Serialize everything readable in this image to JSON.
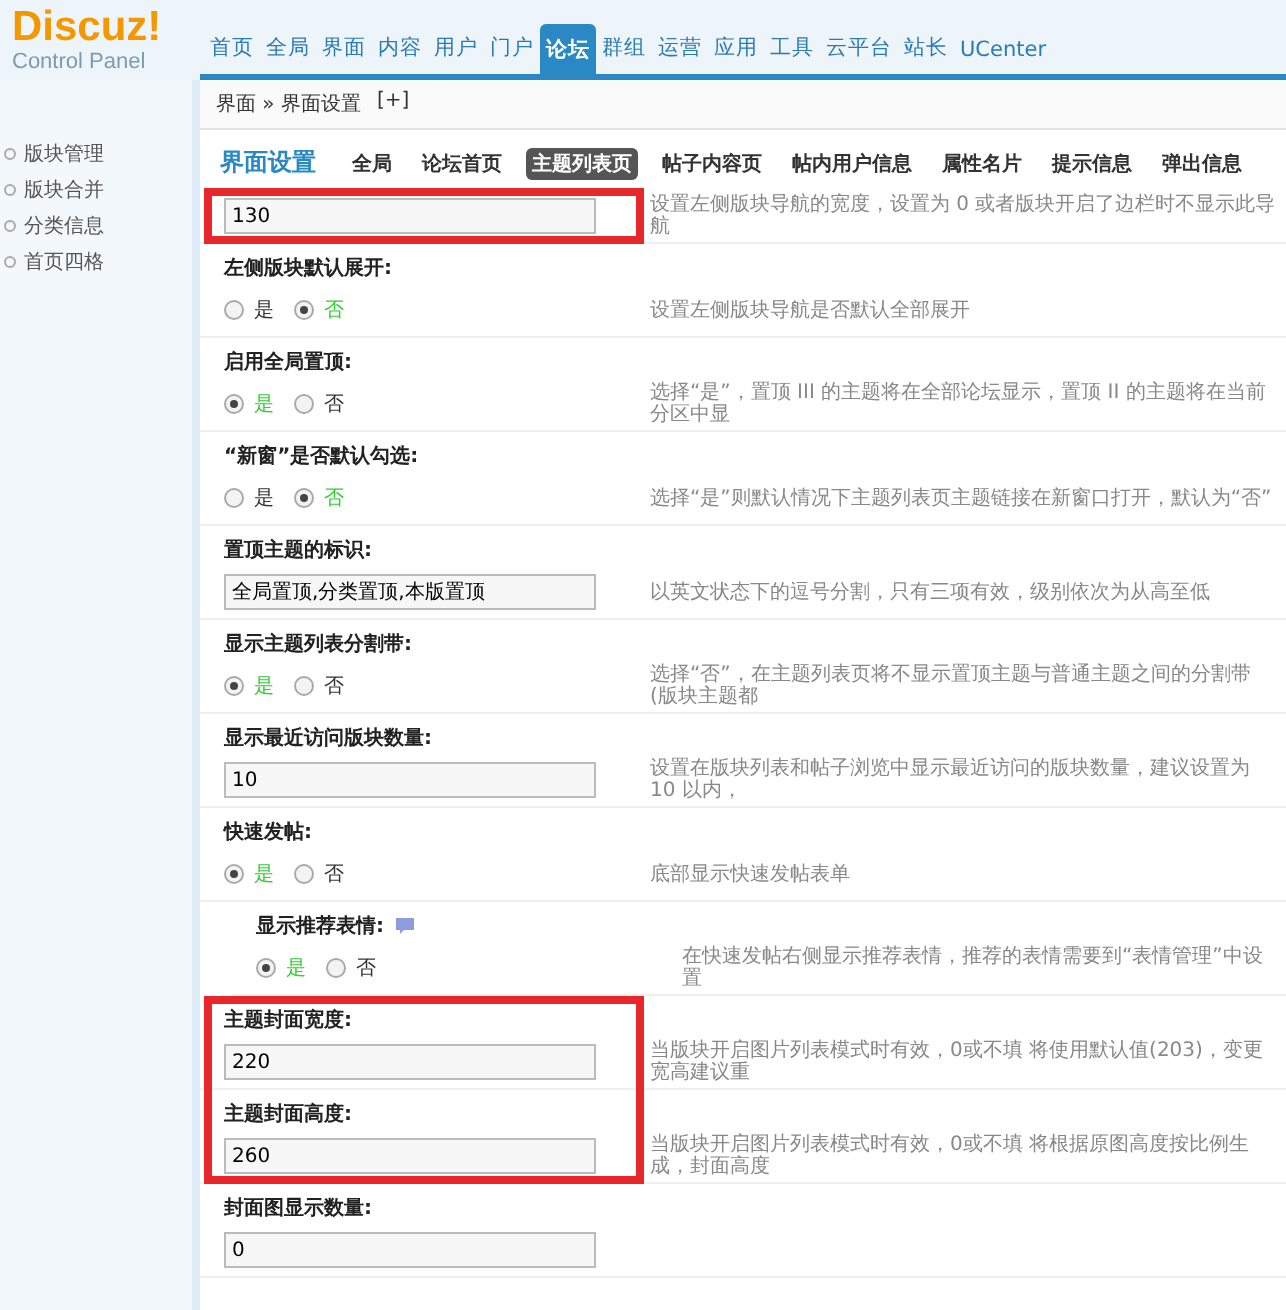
{
  "logo": {
    "name": "Discuz!",
    "subtitle": "Control Panel"
  },
  "nav": [
    {
      "label": "首页",
      "selected": false
    },
    {
      "label": "全局",
      "selected": false
    },
    {
      "label": "界面",
      "selected": false
    },
    {
      "label": "内容",
      "selected": false
    },
    {
      "label": "用户",
      "selected": false
    },
    {
      "label": "门户",
      "selected": false
    },
    {
      "label": "论坛",
      "selected": true
    },
    {
      "label": "群组",
      "selected": false
    },
    {
      "label": "运营",
      "selected": false
    },
    {
      "label": "应用",
      "selected": false
    },
    {
      "label": "工具",
      "selected": false
    },
    {
      "label": "云平台",
      "selected": false
    },
    {
      "label": "站长",
      "selected": false
    },
    {
      "label": "UCenter",
      "selected": false
    }
  ],
  "sidebar": {
    "items": [
      "版块管理",
      "版块合并",
      "分类信息",
      "首页四格"
    ]
  },
  "breadcrumb": {
    "path": "界面 » 界面设置",
    "add": "[+]"
  },
  "section_title": "界面设置",
  "tabs": [
    {
      "label": "全局",
      "selected": false
    },
    {
      "label": "论坛首页",
      "selected": false
    },
    {
      "label": "主题列表页",
      "selected": true
    },
    {
      "label": "帖子内容页",
      "selected": false
    },
    {
      "label": "帖内用户信息",
      "selected": false
    },
    {
      "label": "属性名片",
      "selected": false
    },
    {
      "label": "提示信息",
      "selected": false
    },
    {
      "label": "弹出信息",
      "selected": false
    }
  ],
  "settings": [
    {
      "kind": "text",
      "value": "130",
      "hint": "设置左侧版块导航的宽度，设置为 0 或者版块开启了边栏时不显示此导航",
      "highlighted": true
    },
    {
      "kind": "radio",
      "label": "左侧版块默认展开:",
      "options": [
        {
          "label": "是",
          "selected": false
        },
        {
          "label": "否",
          "selected": true
        }
      ],
      "hint": "设置左侧版块导航是否默认全部展开",
      "highlighted": false
    },
    {
      "kind": "radio",
      "label": "启用全局置顶:",
      "options": [
        {
          "label": "是",
          "selected": true
        },
        {
          "label": "否",
          "selected": false
        }
      ],
      "hint": "选择“是”，置顶 III 的主题将在全部论坛显示，置顶 II 的主题将在当前分区中显",
      "highlighted": false
    },
    {
      "kind": "radio",
      "label": "“新窗”是否默认勾选:",
      "options": [
        {
          "label": "是",
          "selected": false
        },
        {
          "label": "否",
          "selected": true
        }
      ],
      "hint": "选择“是”则默认情况下主题列表页主题链接在新窗口打开，默认为“否”",
      "highlighted": false
    },
    {
      "kind": "text",
      "label": "置顶主题的标识:",
      "value": "全局置顶,分类置顶,本版置顶",
      "hint": "以英文状态下的逗号分割，只有三项有效，级别依次为从高至低",
      "highlighted": false
    },
    {
      "kind": "radio",
      "label": "显示主题列表分割带:",
      "options": [
        {
          "label": "是",
          "selected": true
        },
        {
          "label": "否",
          "selected": false
        }
      ],
      "hint": "选择“否”，在主题列表页将不显示置顶主题与普通主题之间的分割带(版块主题都",
      "highlighted": false
    },
    {
      "kind": "text",
      "label": "显示最近访问版块数量:",
      "value": "10",
      "hint": "设置在版块列表和帖子浏览中显示最近访问的版块数量，建议设置为 10 以内，",
      "highlighted": false
    },
    {
      "kind": "radio",
      "label": "快速发帖:",
      "options": [
        {
          "label": "是",
          "selected": true
        },
        {
          "label": "否",
          "selected": false
        }
      ],
      "hint": "底部显示快速发帖表单",
      "highlighted": false
    },
    {
      "kind": "radio",
      "label": "显示推荐表情:",
      "sub": true,
      "help": true,
      "options": [
        {
          "label": "是",
          "selected": true
        },
        {
          "label": "否",
          "selected": false
        }
      ],
      "hint": "在快速发帖右侧显示推荐表情，推荐的表情需要到“表情管理”中设置",
      "highlighted": false
    },
    {
      "kind": "text",
      "label": "主题封面宽度:",
      "value": "220",
      "hint": "当版块开启图片列表模式时有效，0或不填 将使用默认值(203)，变更宽高建议重",
      "highlighted": true
    },
    {
      "kind": "text",
      "label": "主题封面高度:",
      "value": "260",
      "hint": "当版块开启图片列表模式时有效，0或不填 将根据原图高度按比例生成，封面高度",
      "highlighted": true
    },
    {
      "kind": "text",
      "label": "封面图显示数量:",
      "value": "0",
      "highlighted": false
    }
  ]
}
